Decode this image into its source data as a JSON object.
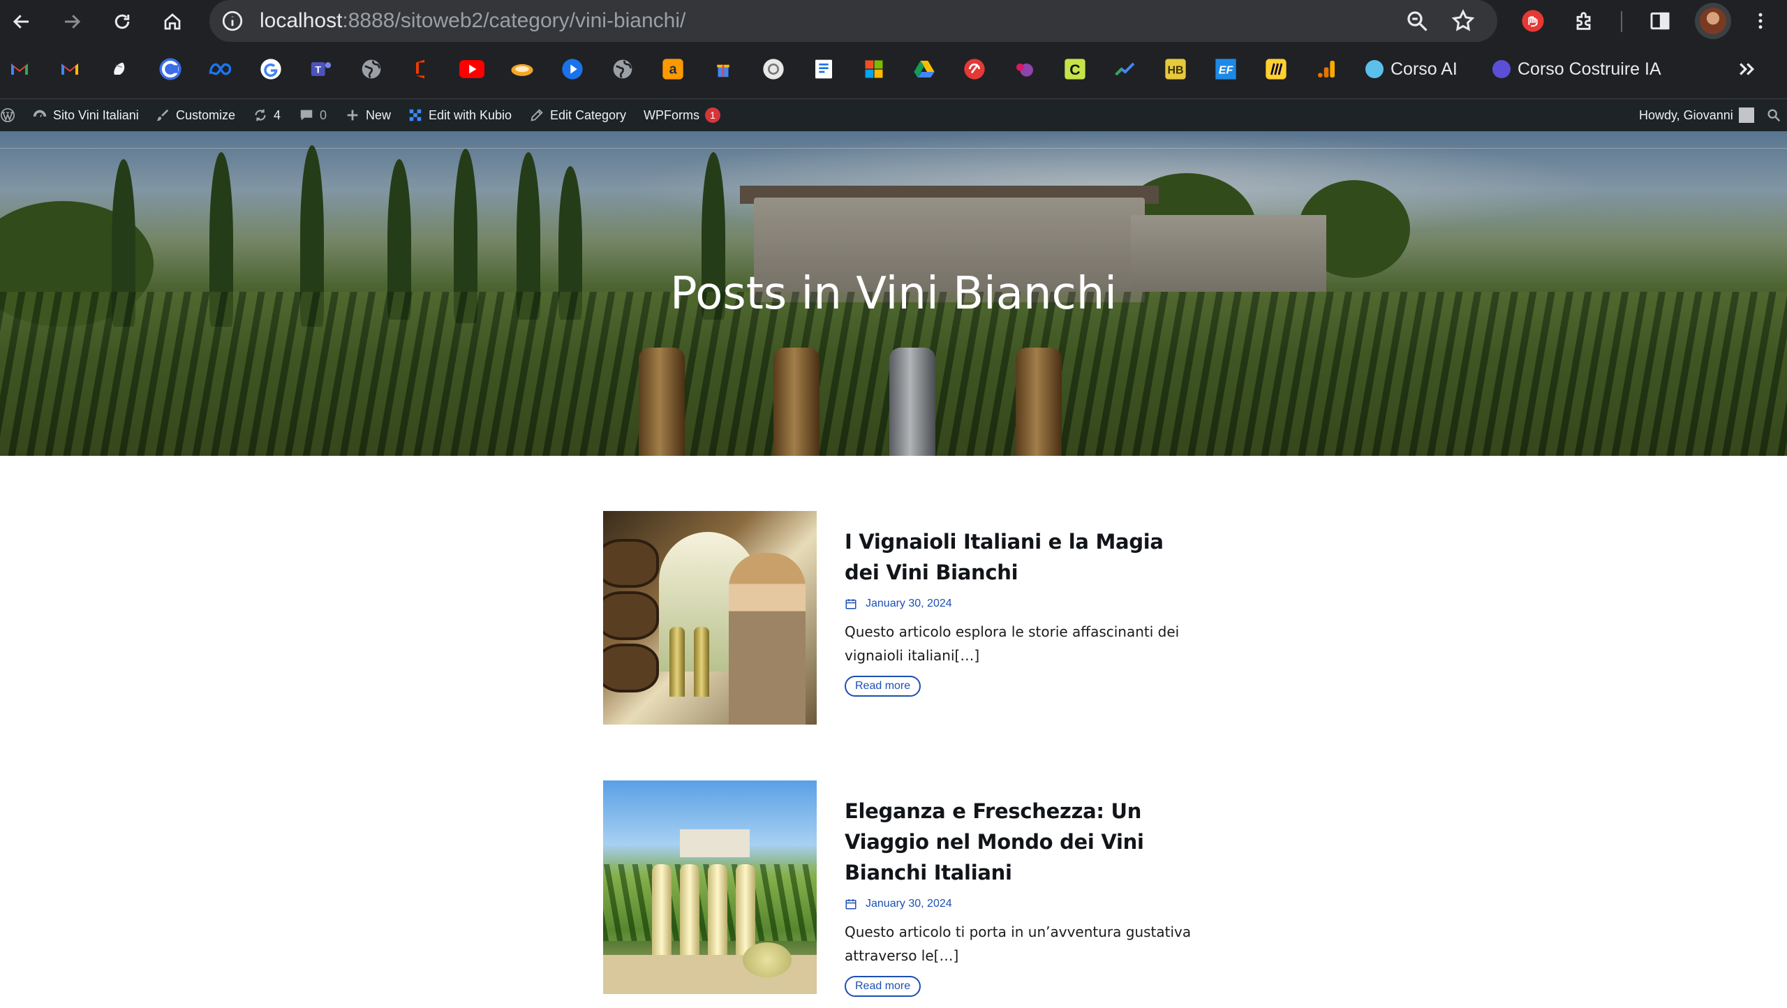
{
  "browser": {
    "url_host": "localhost",
    "url_rest": ":8888/sitoweb2/category/vini-bianchi/",
    "icons": [
      "back-arrow-icon",
      "forward-arrow-icon",
      "reload-icon",
      "home-icon",
      "site-info-icon",
      "zoom-icon",
      "bookmark-star-icon",
      "extension-red-icon",
      "extensions-puzzle-icon",
      "side-panel-icon",
      "profile-avatar",
      "kebab-menu-icon"
    ]
  },
  "bookmarks": {
    "icons": [
      "gmail-icon",
      "gmail-icon-2",
      "bard-icon",
      "copilot-icon",
      "meta-icon",
      "google-icon",
      "teams-icon",
      "globe-icon",
      "office-icon",
      "youtube-icon",
      "swirl-icon",
      "play-icon",
      "globe-icon-2",
      "amazon-icon",
      "gift-icon",
      "chatgpt-icon",
      "document-icon",
      "microsoft-icon",
      "drive-icon",
      "brand-red-icon",
      "purple-blob-icon",
      "c-icon",
      "chart-line-icon",
      "hb-icon",
      "ef-icon",
      "miro-icon",
      "analytics-icon"
    ],
    "labeled": [
      {
        "label": "Corso AI",
        "color": "#5bc0eb"
      },
      {
        "label": "Corso Costruire IA",
        "color": "#5b4fd8"
      }
    ],
    "overflow_icon": "chevron-double-right-icon"
  },
  "adminbar": {
    "site_name": "Sito Vini Italiani",
    "customize": "Customize",
    "updates_count": "4",
    "comments_count": "0",
    "new": "New",
    "edit_kubio": "Edit with Kubio",
    "edit_category": "Edit Category",
    "wpforms": "WPForms",
    "wpforms_badge": "1",
    "howdy": "Howdy, Giovanni"
  },
  "hero": {
    "title": "Posts in Vini Bianchi"
  },
  "posts": [
    {
      "title": "I Vignaioli Italiani e la Magia dei Vini Bianchi",
      "date": "January 30, 2024",
      "excerpt": "Questo articolo esplora le storie affascinanti dei vignaioli italiani[…]",
      "read_more": "Read more"
    },
    {
      "title": "Eleganza e Freschezza: Un Viaggio nel Mondo dei Vini Bianchi Italiani",
      "date": "January 30, 2024",
      "excerpt": "Questo articolo ti porta in un’avventura gustativa attraverso le[…]",
      "read_more": "Read more"
    }
  ],
  "colors": {
    "accent": "#1c4fb4",
    "adminbar_bg": "#1d2327",
    "chrome_bg": "#202124"
  }
}
